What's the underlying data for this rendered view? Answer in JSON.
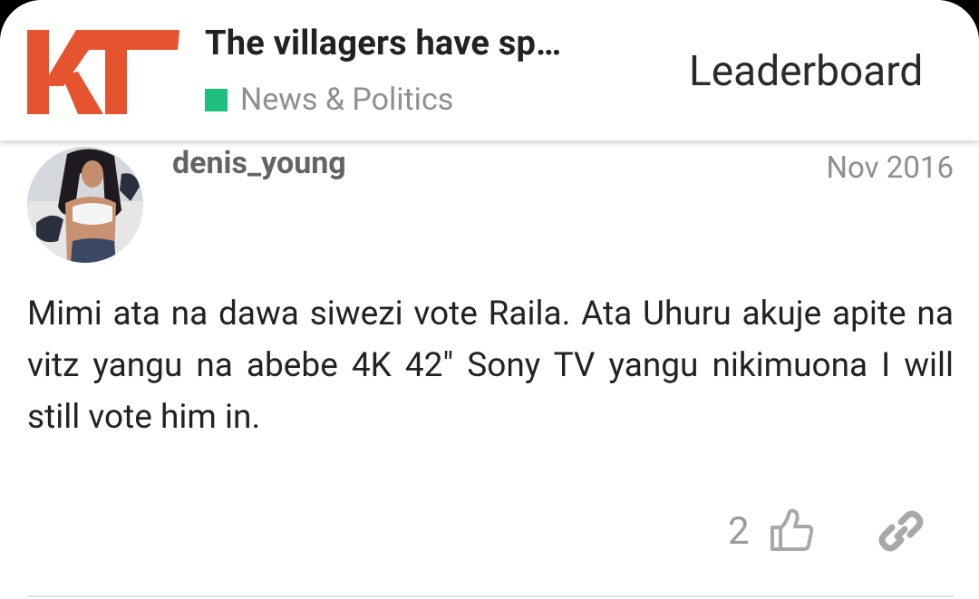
{
  "header": {
    "logo_text": "KT",
    "topic_title": "The villagers have sp…",
    "category": {
      "label": "News & Politics",
      "color": "#1fbf7f"
    },
    "leaderboard_label": "Leaderboard"
  },
  "post": {
    "username": "denis_young",
    "date": "Nov 2016",
    "avatar_icon": "user-avatar",
    "body": "Mimi ata na dawa siwezi vote Raila. Ata Uhuru akuje apite na vitz yangu na abebe 4K 42\" Sony TV yangu nikimuona I will still vote him in.",
    "like_count": "2",
    "like_icon": "thumbs-up-icon",
    "link_icon": "link-icon"
  },
  "colors": {
    "logo": "#e5532f",
    "accent_category": "#1fbf7f",
    "muted_text": "#8f8f8f",
    "icon_gray": "#a8a8a8"
  }
}
